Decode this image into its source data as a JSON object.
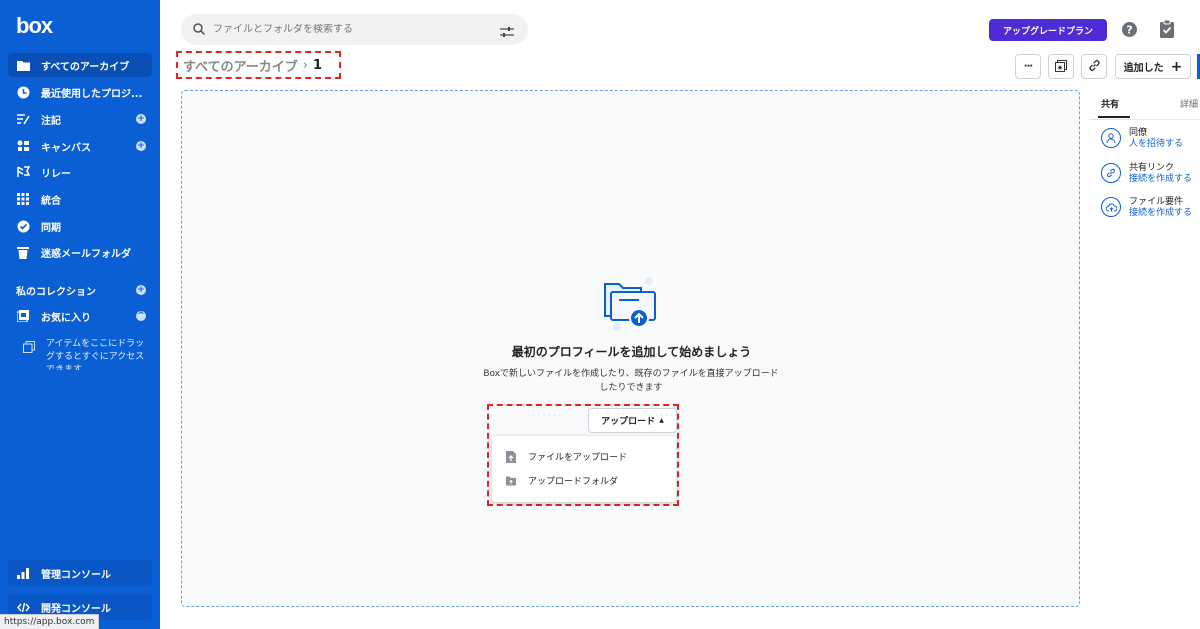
{
  "sidebar": {
    "logo": "box",
    "items": [
      {
        "label": "すべてのアーカイブ",
        "icon": "folder-icon"
      },
      {
        "label": "最近使用したプロジ...",
        "icon": "clock-icon"
      },
      {
        "label": "注記",
        "icon": "notes-icon"
      },
      {
        "label": "キャンバス",
        "icon": "canvas-icon"
      },
      {
        "label": "リレー",
        "icon": "relay-icon"
      },
      {
        "label": "統合",
        "icon": "grid-icon"
      },
      {
        "label": "同期",
        "icon": "check-circle-icon"
      },
      {
        "label": "迷惑メールフォルダ",
        "icon": "trash-icon"
      }
    ],
    "collections_label": "私のコレクション",
    "favorites_label": "お気に入り",
    "favorites_empty": "アイテムをここにドラッグするとすぐにアクセスできます",
    "admin_console": "管理コンソール",
    "dev_console": "開発コンソール"
  },
  "status_url": "https://app.box.com",
  "search": {
    "placeholder": "ファイルとフォルダを検索する"
  },
  "header": {
    "upgrade_label": "アップグレードプラン"
  },
  "breadcrumb": {
    "root": "すべてのアーカイブ",
    "separator": "›",
    "current": "1"
  },
  "toolbar": {
    "add_label": "追加した",
    "add_plus": "+",
    "more_label": "···"
  },
  "empty_state": {
    "title": "最初のプロフィールを追加して始めましょう",
    "description": "Boxで新しいファイルを作成したり、既存のファイルを直接アップロードしたりできます"
  },
  "upload": {
    "button_label": "アップロード",
    "caret": "▲",
    "menu": [
      "ファイルをアップロード",
      "アップロードフォルダ"
    ]
  },
  "right_panel": {
    "tabs": [
      "共有",
      "詳細"
    ],
    "rows": [
      {
        "title": "同僚",
        "link": "人を招待する",
        "icon": "person-icon"
      },
      {
        "title": "共有リンク",
        "link": "接続を作成する",
        "icon": "link-icon"
      },
      {
        "title": "ファイル要件",
        "link": "接続を作成する",
        "icon": "cloud-upload-icon"
      }
    ]
  },
  "colors": {
    "sidebar": "#0b5fd4",
    "upgrade": "#4e2bd4",
    "highlight": "#e0261f"
  }
}
